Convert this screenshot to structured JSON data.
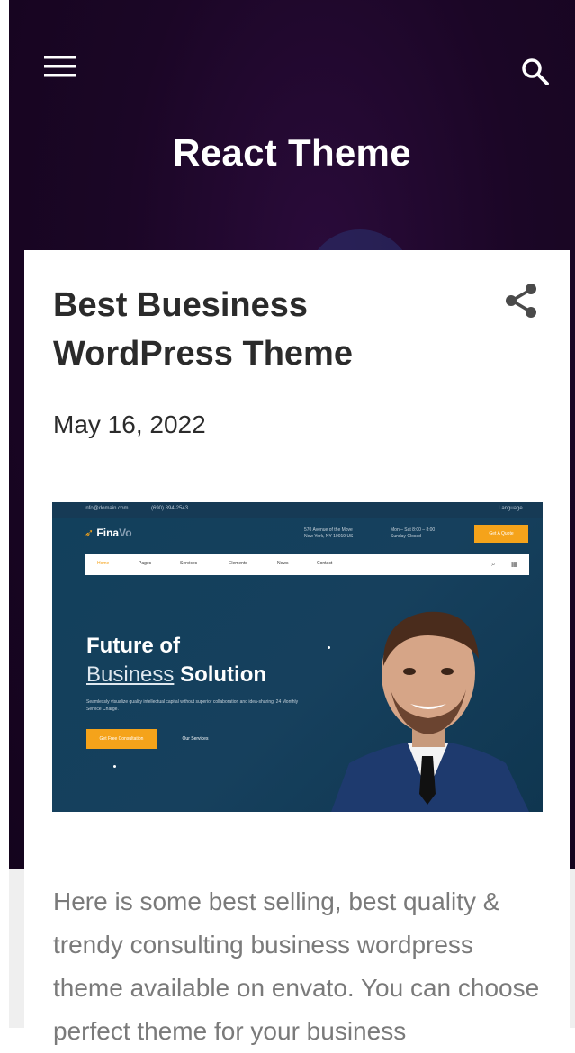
{
  "header": {
    "title": "React Theme",
    "menu_icon": "hamburger-menu-icon",
    "search_icon": "search-icon"
  },
  "post": {
    "title": "Best Buesiness WordPress Theme",
    "date": "May 16, 2022",
    "share_icon": "share-icon",
    "excerpt": "Here is some best selling, best quality & trendy consulting business wordpress theme available on envato. You can choose perfect theme for your business"
  },
  "featured_image": {
    "logo_text": "Fina",
    "logo_suffix": "Vo",
    "topbar_email": "info@domain.com",
    "topbar_phone": "(690) 894-2543",
    "topbar_language": "Language",
    "address_line1": "570 Avenue of the Move",
    "address_line2": "New York, NY 10019 US",
    "hours_line1": "Mon – Sat 8:00 – 8:00",
    "hours_line2": "Sunday Closed",
    "quote_button": "Get A Quote",
    "nav": [
      "Home",
      "Pages",
      "Services",
      "Elements",
      "News",
      "Contact"
    ],
    "headline_line1": "Future of",
    "headline_word_underlined": "Business",
    "headline_word_bold": "Solution",
    "subtext": "Seamlessly visualize quality intellectual capital without superior collaboration and idea-sharing. 24 Monthly Service Charge.",
    "primary_button": "Get Free Consultation",
    "secondary_button": "Our Services"
  },
  "colors": {
    "header_bg": "#1b0626",
    "accent_orange": "#f5a31a",
    "hero_bg": "#12405c",
    "title_text": "#2b2b2b",
    "excerpt_text": "#7a7a7a"
  }
}
